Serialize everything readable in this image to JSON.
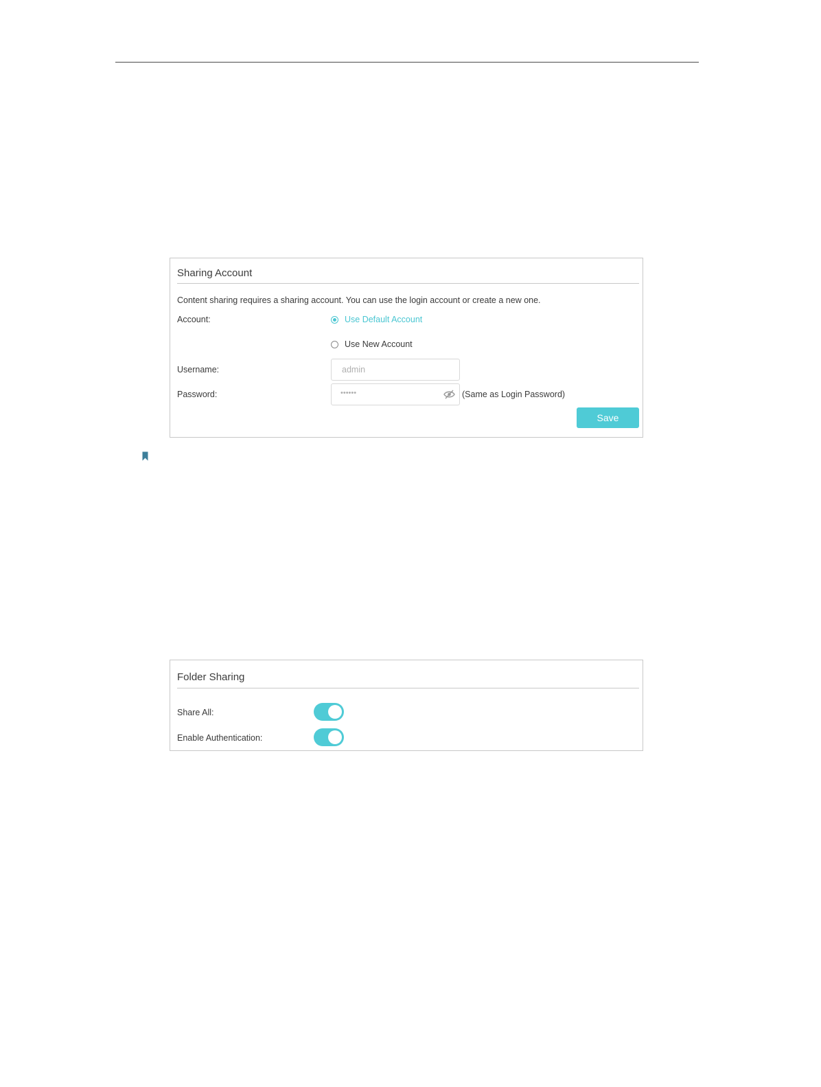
{
  "sharing_account": {
    "title": "Sharing Account",
    "description": "Content sharing requires a sharing account. You can use the login account or create a new one.",
    "account_label": "Account:",
    "options": [
      "Use Default Account",
      "Use New Account"
    ],
    "selected_option": "Use Default Account",
    "username_label": "Username:",
    "username_value": "admin",
    "password_label": "Password:",
    "password_value": "••••••",
    "password_note": "(Same as Login Password)",
    "save_label": "Save"
  },
  "folder_sharing": {
    "title": "Folder Sharing",
    "share_all_label": "Share All:",
    "share_all_enabled": true,
    "auth_label": "Enable Authentication:",
    "auth_enabled": true
  },
  "colors": {
    "accent": "#4fcbd6",
    "border": "#c8c8c8"
  }
}
